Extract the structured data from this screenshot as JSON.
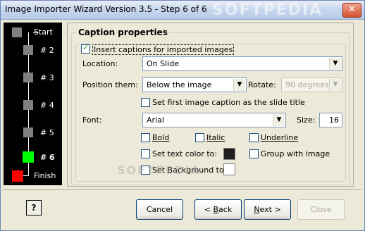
{
  "window": {
    "title": "Image Importer Wizard Version 3.5 - Step 6 of 6",
    "close_glyph": "✕",
    "watermark": "SOFTPEDIA"
  },
  "steps": [
    {
      "label": "Start",
      "state": "done",
      "color": "#808080"
    },
    {
      "label": "# 2",
      "state": "done",
      "color": "#808080"
    },
    {
      "label": "# 3",
      "state": "done",
      "color": "#808080"
    },
    {
      "label": "# 4",
      "state": "done",
      "color": "#808080"
    },
    {
      "label": "# 5",
      "state": "done",
      "color": "#808080"
    },
    {
      "label": "# 6",
      "state": "current",
      "color": "#00ff00"
    },
    {
      "label": "Finish",
      "state": "pending",
      "color": "#ff0000"
    }
  ],
  "caption": {
    "group_title": "Caption properties",
    "insert_label": "Insert captions for imported images",
    "insert_checked": true,
    "location_label": "Location:",
    "location_value": "On Slide",
    "position_label": "Position them:",
    "position_value": "Below the image",
    "rotate_label": "Rotate:",
    "rotate_value": "90 degrees",
    "first_caption_label": "Set first image caption as the slide title",
    "first_caption_checked": false,
    "font_label": "Font:",
    "font_value": "Arial",
    "size_label": "Size:",
    "size_value": "16",
    "bold_label": "Bold",
    "italic_label": "Italic",
    "underline_label": "Underline",
    "text_color_label": "Set text color to:",
    "text_color": "#1e1e1e",
    "group_with_image_label": "Group with image",
    "background_label": "Set Background to:",
    "background_color": "#ffffff"
  },
  "buttons": {
    "help": "?",
    "cancel": "Cancel",
    "back_lt": "< ",
    "back_u": "B",
    "back_rest": "ack",
    "next_u": "N",
    "next_rest": "ext >",
    "close": "Close"
  }
}
